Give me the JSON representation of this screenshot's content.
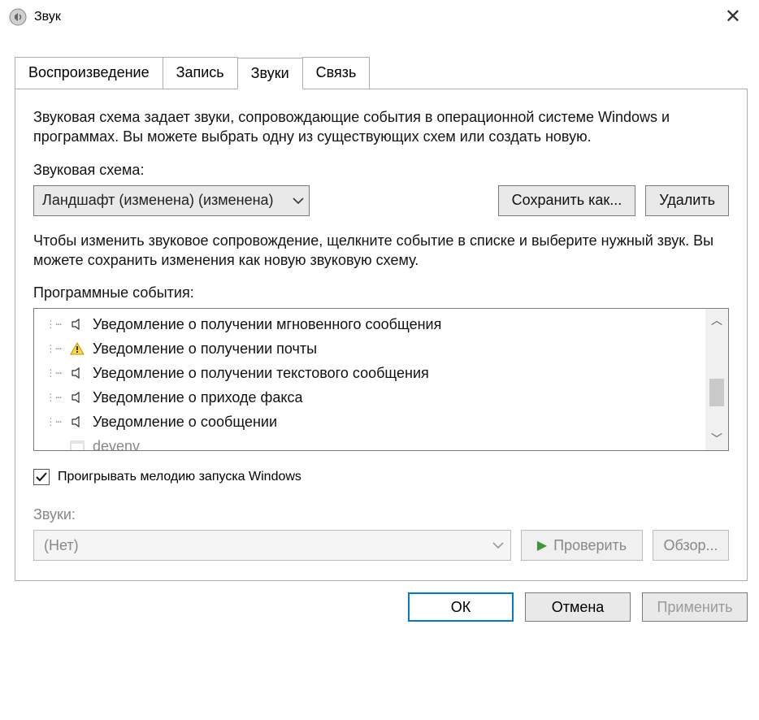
{
  "title": "Звук",
  "tabs": [
    "Воспроизведение",
    "Запись",
    "Звуки",
    "Связь"
  ],
  "activeTab": 2,
  "description": "Звуковая схема задает звуки, сопровождающие события в операционной системе Windows и программах. Вы можете выбрать одну из существующих схем или создать новую.",
  "schemeLabel": "Звуковая схема:",
  "schemeValue": "Ландшафт (изменена) (изменена)",
  "saveAsLabel": "Сохранить как...",
  "deleteLabel": "Удалить",
  "eventsDesc": "Чтобы изменить звуковое сопровождение, щелкните событие в списке и выберите нужный звук. Вы можете сохранить изменения как новую звуковую схему.",
  "eventsLabel": "Программные события:",
  "events": [
    {
      "label": "Уведомление о получении мгновенного сообщения",
      "icon": "speaker"
    },
    {
      "label": "Уведомление о получении почты",
      "icon": "warning"
    },
    {
      "label": "Уведомление о получении текстового сообщения",
      "icon": "speaker"
    },
    {
      "label": "Уведомление о приходе факса",
      "icon": "speaker"
    },
    {
      "label": "Уведомление о сообщении",
      "icon": "speaker"
    },
    {
      "label": "devenv",
      "icon": "app"
    }
  ],
  "playStartupLabel": "Проигрывать мелодию запуска Windows",
  "playStartupChecked": true,
  "soundsLabel": "Звуки:",
  "soundsValue": "(Нет)",
  "testLabel": "Проверить",
  "browseLabel": "Обзор...",
  "okLabel": "ОК",
  "cancelLabel": "Отмена",
  "applyLabel": "Применить"
}
